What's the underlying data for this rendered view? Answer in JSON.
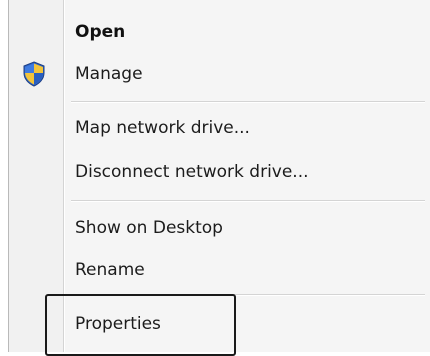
{
  "menu": {
    "items": [
      {
        "label": "Open",
        "bold": true
      },
      {
        "label": "Manage",
        "icon": "uac-shield-icon"
      },
      {
        "label": "Map network drive..."
      },
      {
        "label": "Disconnect network drive..."
      },
      {
        "label": "Show on Desktop"
      },
      {
        "label": "Rename"
      },
      {
        "label": "Properties",
        "highlighted": true
      }
    ]
  },
  "colors": {
    "menu_background": "#f5f5f5",
    "text": "#1c1c1c",
    "separator": "#d4d4d4",
    "highlight_outline": "#1a1a1a",
    "shield_blue": "#2f66c7",
    "shield_yellow": "#f3c43a"
  }
}
